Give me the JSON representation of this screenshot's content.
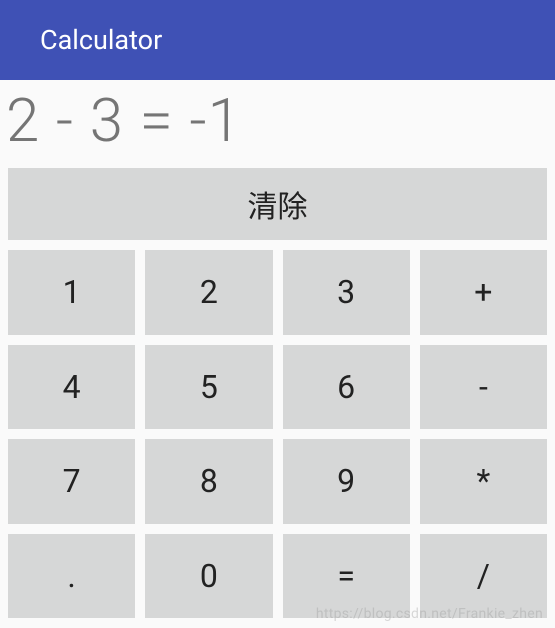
{
  "header": {
    "title": "Calculator"
  },
  "display": {
    "expression": "2 - 3 = -1"
  },
  "keypad": {
    "clear_label": "清除",
    "keys": [
      "1",
      "2",
      "3",
      "+",
      "4",
      "5",
      "6",
      "-",
      "7",
      "8",
      "9",
      "*",
      ".",
      "0",
      "=",
      "/"
    ]
  },
  "watermark": "https://blog.csdn.net/Frankie_zhen"
}
